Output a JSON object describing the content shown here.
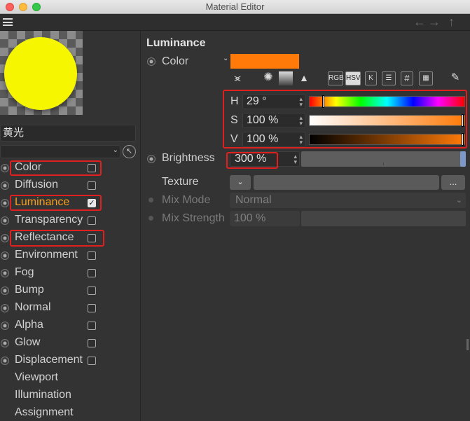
{
  "window": {
    "title": "Material Editor"
  },
  "menubar": {
    "back_icon": "arrow-left-icon",
    "forward_icon": "arrow-right-icon",
    "up_icon": "arrow-up-icon"
  },
  "material": {
    "name": "黄光",
    "preview_color": "#f6f600"
  },
  "channels": [
    {
      "label": "Color",
      "checked": false,
      "has_radio": true,
      "has_checkbox": true
    },
    {
      "label": "Diffusion",
      "checked": false,
      "has_radio": true,
      "has_checkbox": true
    },
    {
      "label": "Luminance",
      "checked": true,
      "has_radio": true,
      "has_checkbox": true,
      "active": true
    },
    {
      "label": "Transparency",
      "checked": false,
      "has_radio": true,
      "has_checkbox": true
    },
    {
      "label": "Reflectance",
      "checked": false,
      "has_radio": true,
      "has_checkbox": true
    },
    {
      "label": "Environment",
      "checked": false,
      "has_radio": true,
      "has_checkbox": true
    },
    {
      "label": "Fog",
      "checked": false,
      "has_radio": true,
      "has_checkbox": true
    },
    {
      "label": "Bump",
      "checked": false,
      "has_radio": true,
      "has_checkbox": true
    },
    {
      "label": "Normal",
      "checked": false,
      "has_radio": true,
      "has_checkbox": true
    },
    {
      "label": "Alpha",
      "checked": false,
      "has_radio": true,
      "has_checkbox": true
    },
    {
      "label": "Glow",
      "checked": false,
      "has_radio": true,
      "has_checkbox": true
    },
    {
      "label": "Displacement",
      "checked": false,
      "has_radio": true,
      "has_checkbox": true
    },
    {
      "label": "Viewport",
      "has_radio": false,
      "has_checkbox": false
    },
    {
      "label": "Illumination",
      "has_radio": false,
      "has_checkbox": false
    },
    {
      "label": "Assignment",
      "has_radio": false,
      "has_checkbox": false
    }
  ],
  "section": {
    "title": "Luminance"
  },
  "color": {
    "label": "Color",
    "swatch": "#ff7a08",
    "modes": [
      "RGB",
      "HSV",
      "K"
    ],
    "active_mode": "HSV",
    "hex_label": "#",
    "h_label": "H",
    "h_value": "29 °",
    "h_fraction": 0.08,
    "s_label": "S",
    "s_value": "100 %",
    "s_fraction": 1.0,
    "v_label": "V",
    "v_value": "100 %",
    "v_fraction": 1.0
  },
  "brightness": {
    "label": "Brightness",
    "value": "300 %"
  },
  "texture": {
    "label": "Texture",
    "menu_button": "..."
  },
  "mix_mode": {
    "label": "Mix Mode",
    "value": "Normal"
  },
  "mix_strength": {
    "label": "Mix Strength",
    "value": "100 %"
  },
  "highlight_color": "#e02020"
}
